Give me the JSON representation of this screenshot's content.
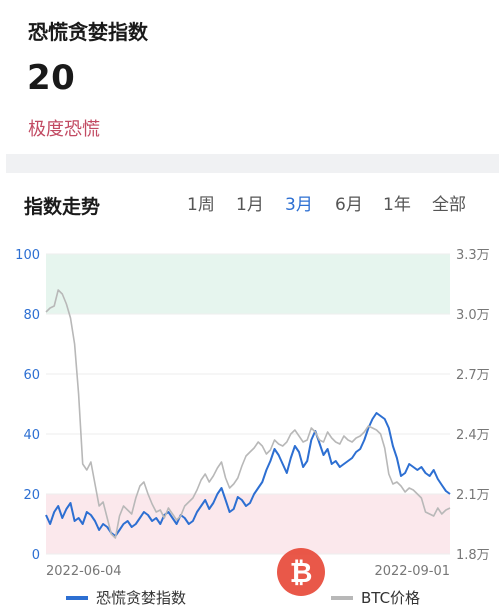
{
  "header": {
    "title": "恐慌贪婪指数",
    "value": "20",
    "status": "极度恐慌",
    "status_color": "#c24a62"
  },
  "trend": {
    "title": "指数走势",
    "tabs": [
      {
        "label": "1周",
        "active": false
      },
      {
        "label": "1月",
        "active": false
      },
      {
        "label": "3月",
        "active": true
      },
      {
        "label": "6月",
        "active": false
      },
      {
        "label": "1年",
        "active": false
      },
      {
        "label": "全部",
        "active": false
      }
    ],
    "active_color": "#2d6fd2"
  },
  "watermark": {
    "icon": "bitcoin-logo-icon",
    "color": "#e84a3a"
  },
  "chart_data": {
    "type": "line",
    "left_axis": {
      "ticks": [
        "100",
        "80",
        "60",
        "40",
        "20",
        "0"
      ],
      "range": [
        0,
        100
      ],
      "color": "#2d6fd2"
    },
    "right_axis": {
      "ticks": [
        "3.3万",
        "3.0万",
        "2.7万",
        "2.4万",
        "2.1万",
        "1.8万"
      ],
      "range": [
        18000,
        33000
      ],
      "color": "#777777"
    },
    "x_labels": [
      "2022-06-04",
      "2022-09-01"
    ],
    "zones": [
      {
        "from": 80,
        "to": 100,
        "color": "#e6f5ee"
      },
      {
        "from": 0,
        "to": 20,
        "color": "#fbe8ec"
      }
    ],
    "legend": [
      {
        "name": "恐慌贪婪指数",
        "color": "#2d6fd2"
      },
      {
        "name": "BTC价格",
        "color": "#b8b8b8"
      }
    ],
    "series": [
      {
        "name": "恐慌贪婪指数",
        "axis": "left",
        "color": "#2d6fd2",
        "values": [
          13,
          10,
          14,
          16,
          12,
          15,
          17,
          11,
          12,
          10,
          14,
          13,
          11,
          8,
          10,
          9,
          7,
          6,
          8,
          10,
          11,
          9,
          10,
          12,
          14,
          13,
          11,
          12,
          10,
          13,
          14,
          12,
          10,
          13,
          12,
          10,
          11,
          14,
          16,
          18,
          15,
          17,
          20,
          22,
          18,
          14,
          15,
          19,
          18,
          16,
          17,
          20,
          22,
          24,
          28,
          31,
          35,
          33,
          30,
          27,
          32,
          36,
          34,
          29,
          31,
          38,
          41,
          37,
          33,
          35,
          30,
          31,
          29,
          30,
          31,
          32,
          34,
          35,
          38,
          42,
          45,
          47,
          46,
          45,
          42,
          36,
          32,
          26,
          27,
          30,
          29,
          28,
          29,
          27,
          26,
          28,
          25,
          23,
          21,
          20
        ]
      },
      {
        "name": "BTC价格",
        "axis": "right",
        "values": [
          30100,
          30300,
          30400,
          31200,
          31000,
          30500,
          29800,
          28500,
          26000,
          22500,
          22200,
          22600,
          21500,
          20400,
          20600,
          19800,
          19000,
          18800,
          19900,
          20400,
          20200,
          20000,
          20800,
          21400,
          21600,
          21000,
          20500,
          20100,
          20200,
          19800,
          20300,
          20000,
          19700,
          19900,
          20400,
          20600,
          20800,
          21200,
          21700,
          22000,
          21600,
          21900,
          22300,
          22600,
          21800,
          21300,
          21500,
          21800,
          22400,
          22900,
          23100,
          23300,
          23600,
          23400,
          23000,
          23200,
          23700,
          23500,
          23400,
          23600,
          24000,
          24200,
          23900,
          23600,
          23700,
          24300,
          24100,
          23700,
          23600,
          24100,
          23800,
          23600,
          23500,
          23900,
          23700,
          23600,
          23800,
          23900,
          24100,
          24400,
          24300,
          24200,
          24000,
          23300,
          22000,
          21500,
          21600,
          21400,
          21100,
          21300,
          21200,
          21000,
          20800,
          20100,
          20000,
          19900,
          20300,
          20000,
          20200,
          20300
        ]
      }
    ]
  }
}
